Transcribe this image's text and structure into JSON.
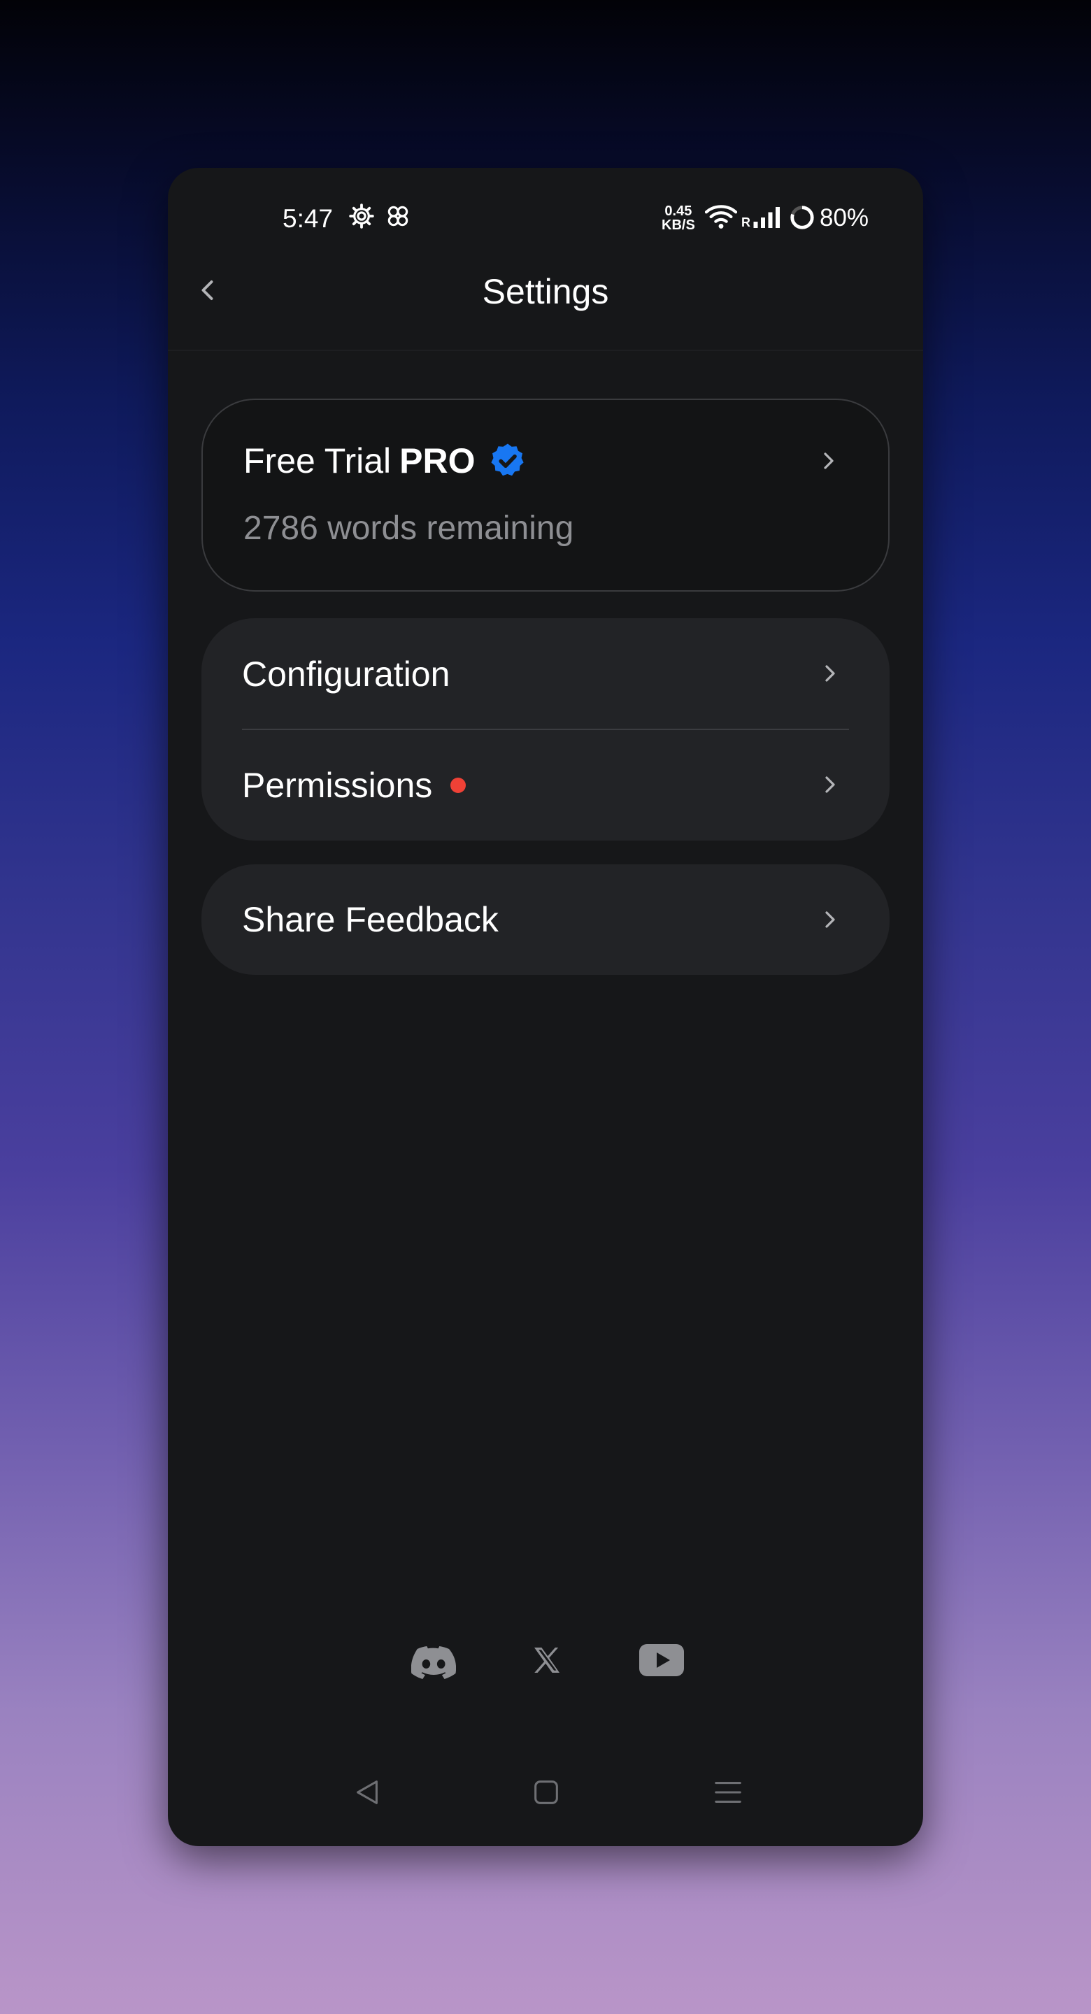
{
  "status_bar": {
    "time": "5:47",
    "net_speed_value": "0.45",
    "net_speed_unit": "KB/S",
    "roaming": "R",
    "battery": "80%"
  },
  "header": {
    "title": "Settings"
  },
  "trial_card": {
    "label": "Free Trial",
    "plan": "PRO",
    "subtitle": "2786 words remaining"
  },
  "settings_group": {
    "items": [
      {
        "label": "Configuration"
      },
      {
        "label": "Permissions",
        "has_alert": true
      }
    ]
  },
  "feedback": {
    "label": "Share Feedback"
  },
  "social": [
    "discord-icon",
    "x-icon",
    "youtube-icon"
  ],
  "colors": {
    "verified_badge": "#1877f2",
    "alert_dot": "#ef4136",
    "card_bg": "#222326",
    "screen_bg": "#161719"
  }
}
